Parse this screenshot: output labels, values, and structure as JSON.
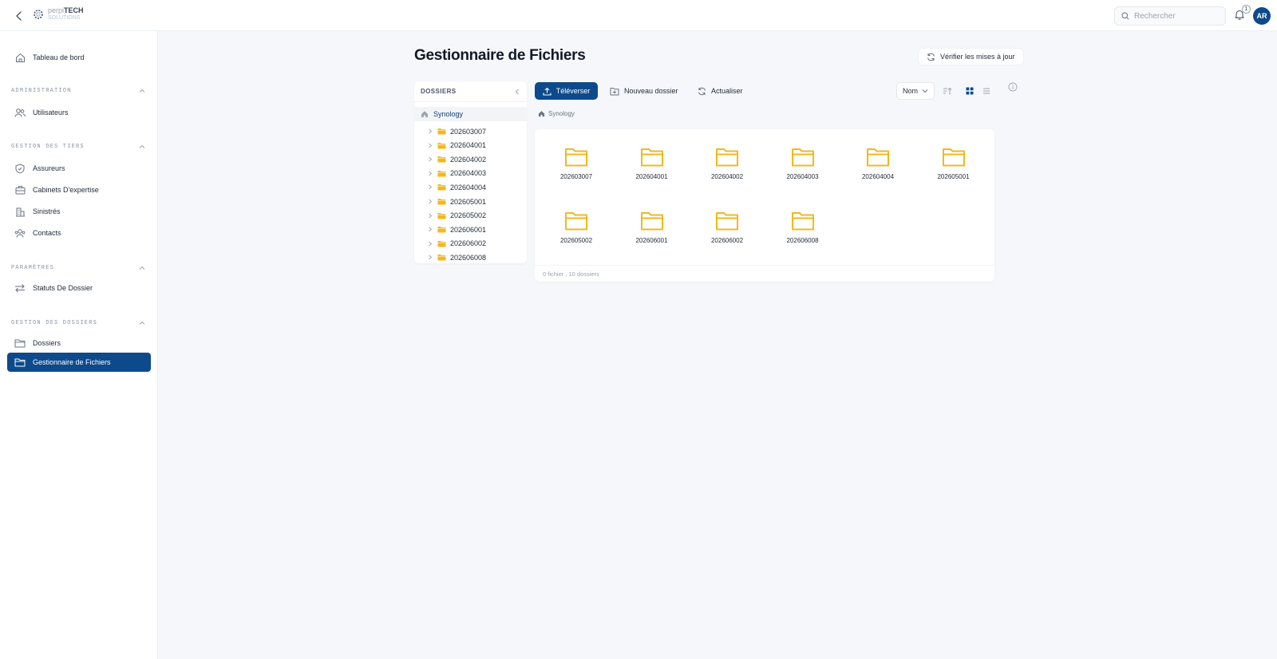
{
  "header": {
    "logo_line1_prefix": "perpi",
    "logo_line1_brand": "TECH",
    "logo_line2": "SOLUTIONS",
    "search_placeholder": "Rechercher",
    "notification_count": "1",
    "avatar_initials": "AR"
  },
  "sidebar": {
    "dashboard": "Tableau de bord",
    "sections": [
      {
        "title": "ADMINISTRATION",
        "items": [
          "Utilisateurs"
        ]
      },
      {
        "title": "GESTION DES TIERS",
        "items": [
          "Assureurs",
          "Cabinets D'expertise",
          "Sinistrés",
          "Contacts"
        ]
      },
      {
        "title": "PARAMÈTRES",
        "items": [
          "Statuts De Dossier"
        ]
      },
      {
        "title": "GESTION DES DOSSIERS",
        "items": [
          "Dossiers",
          "Gestionnaire de Fichiers"
        ]
      }
    ],
    "active_item": "Gestionnaire de Fichiers"
  },
  "main": {
    "title": "Gestionnaire de Fichiers",
    "check_updates_label": "Vérifier les mises à jour",
    "tree": {
      "header": "DOSSIERS",
      "root": "Synology",
      "folders": [
        "202603007",
        "202604001",
        "202604002",
        "202604003",
        "202604004",
        "202605001",
        "202605002",
        "202606001",
        "202606002",
        "202606008"
      ]
    },
    "toolbar": {
      "upload_label": "Téléverser",
      "new_folder_label": "Nouveau dossier",
      "refresh_label": "Actualiser",
      "sort_value": "Nom",
      "view_mode": "grid"
    },
    "breadcrumb": "Synology",
    "grid": {
      "items": [
        "202603007",
        "202604001",
        "202604002",
        "202604003",
        "202604004",
        "202605001",
        "202605002",
        "202606001",
        "202606002",
        "202606008"
      ],
      "footer": "0 fichier , 10 dossiers"
    }
  },
  "colors": {
    "primary": "#0d4a8b",
    "folder": "#f2b81c",
    "background": "#f5f7fa"
  }
}
